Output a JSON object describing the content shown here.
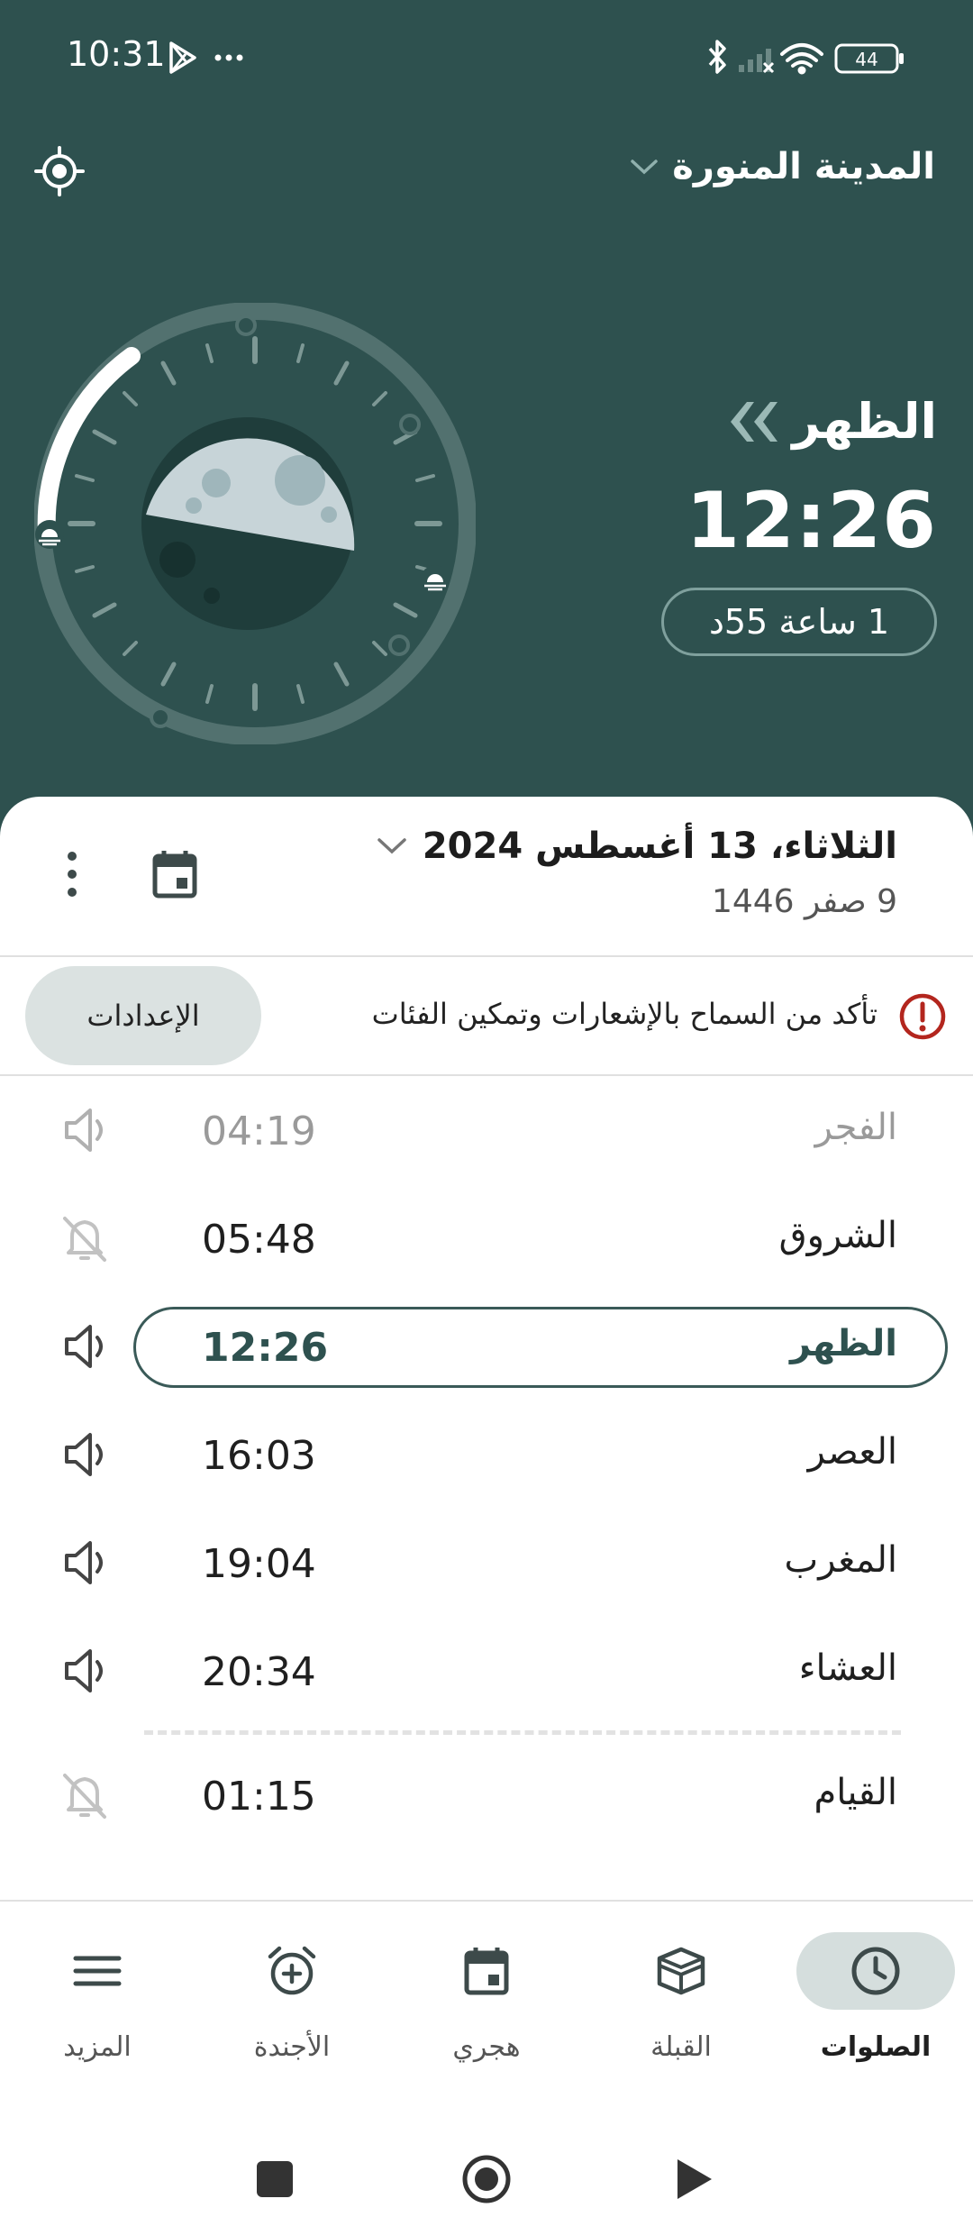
{
  "status_bar": {
    "time": "10:31",
    "battery": "44"
  },
  "header": {
    "city": "المدينة المنورة"
  },
  "next_prayer": {
    "name": "الظهر",
    "time": "12:26",
    "remaining": "1 ساعة 55د"
  },
  "date": {
    "gregorian": "الثلاثاء، 13 أغسطس 2024",
    "hijri": "9 صفر 1446"
  },
  "notice": {
    "text": "تأكد من السماح بالإشعارات وتمكين الفئات",
    "button": "الإعدادات"
  },
  "prayers": [
    {
      "name": "الفجر",
      "time": "04:19",
      "sound": "speaker-icon",
      "state": "past"
    },
    {
      "name": "الشروق",
      "time": "05:48",
      "sound": "bell-off-icon",
      "state": "normal"
    },
    {
      "name": "الظهر",
      "time": "12:26",
      "sound": "speaker-icon",
      "state": "current"
    },
    {
      "name": "العصر",
      "time": "16:03",
      "sound": "speaker-icon",
      "state": "normal"
    },
    {
      "name": "المغرب",
      "time": "19:04",
      "sound": "speaker-icon",
      "state": "normal"
    },
    {
      "name": "العشاء",
      "time": "20:34",
      "sound": "speaker-icon",
      "state": "normal"
    },
    {
      "name": "القيام",
      "time": "01:15",
      "sound": "bell-off-icon",
      "state": "normal"
    }
  ],
  "nav": [
    {
      "label": "الصلوات",
      "icon": "clock-icon",
      "active": true
    },
    {
      "label": "القبلة",
      "icon": "kaaba-icon",
      "active": false
    },
    {
      "label": "هجري",
      "icon": "calendar-icon",
      "active": false
    },
    {
      "label": "الأجندة",
      "icon": "alarm-add-icon",
      "active": false
    },
    {
      "label": "المزيد",
      "icon": "menu-icon",
      "active": false
    }
  ],
  "colors": {
    "primary": "#2e514f",
    "active_nav": "#d5dedd",
    "error": "#b3261e"
  }
}
